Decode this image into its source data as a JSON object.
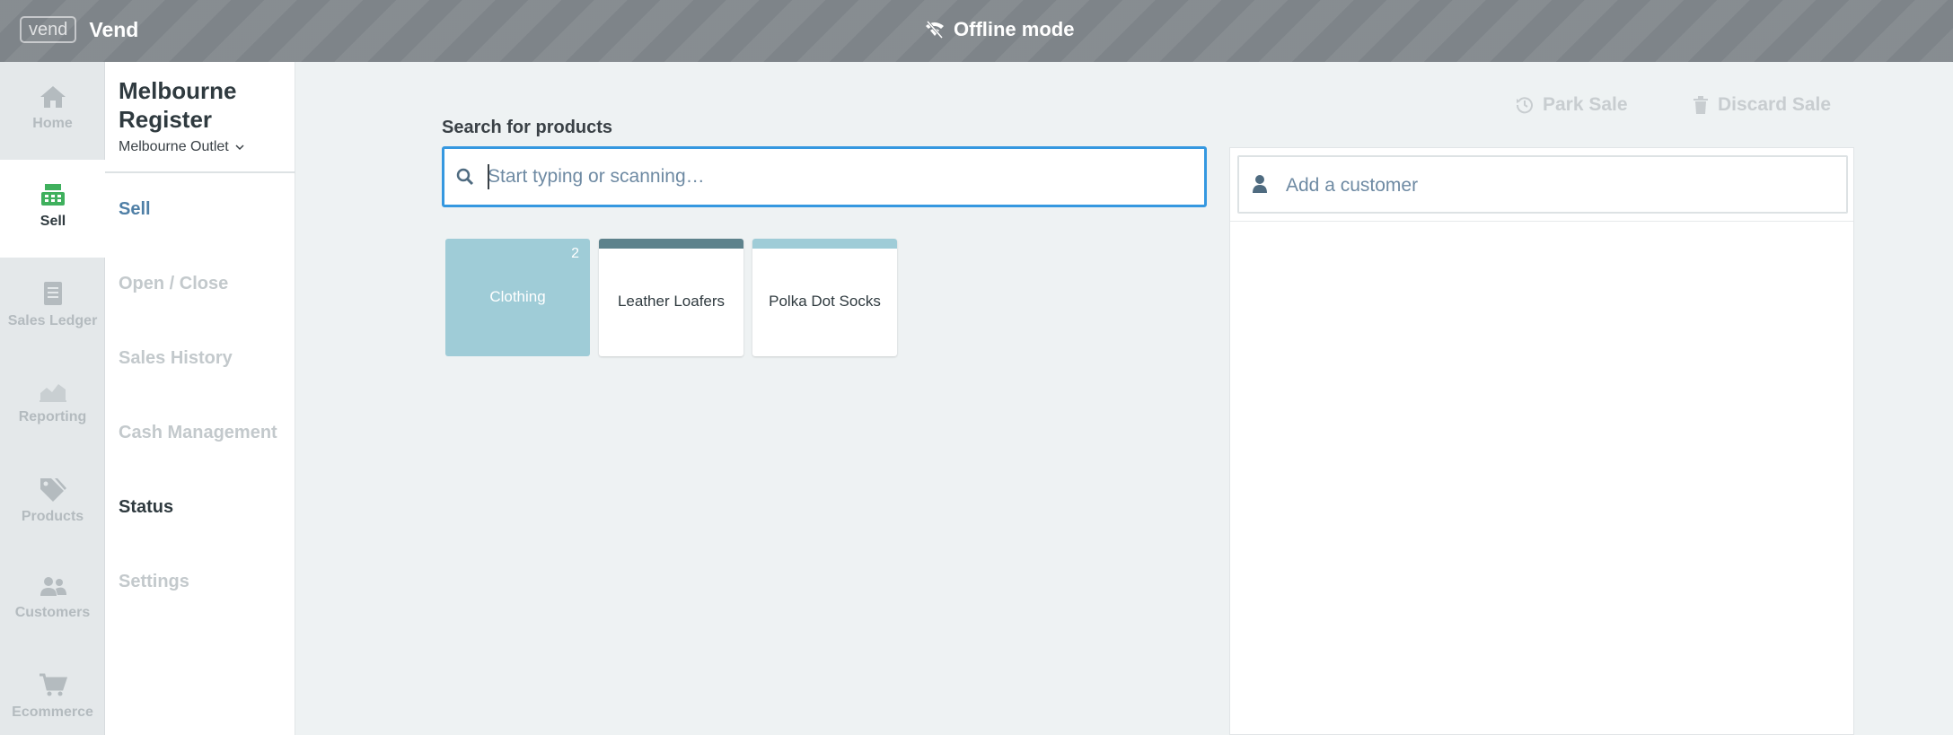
{
  "topbar": {
    "logo_text": "vend",
    "app_name": "Vend",
    "offline_label": "Offline mode"
  },
  "rail": {
    "items": [
      {
        "label": "Home",
        "icon": "home-icon"
      },
      {
        "label": "Sell",
        "icon": "register-icon",
        "active": true
      },
      {
        "label": "Sales Ledger",
        "icon": "ledger-icon"
      },
      {
        "label": "Reporting",
        "icon": "chart-icon"
      },
      {
        "label": "Products",
        "icon": "tags-icon"
      },
      {
        "label": "Customers",
        "icon": "users-icon"
      },
      {
        "label": "Ecommerce",
        "icon": "cart-icon"
      }
    ]
  },
  "subnav": {
    "register_title": "Melbourne Register",
    "outlet": "Melbourne Outlet",
    "items": [
      {
        "label": "Sell",
        "active": true
      },
      {
        "label": "Open / Close"
      },
      {
        "label": "Sales History"
      },
      {
        "label": "Cash Management"
      },
      {
        "label": "Status"
      },
      {
        "label": "Settings"
      }
    ]
  },
  "main": {
    "search_label": "Search for products",
    "search_placeholder": "Start typing or scanning…",
    "search_value": "",
    "park_sale": "Park Sale",
    "discard_sale": "Discard Sale",
    "tiles": [
      {
        "type": "folder",
        "name": "Clothing",
        "count": "2",
        "color": "#9fccd7"
      },
      {
        "type": "product",
        "name": "Leather Loafers",
        "bar_color": "#5d828c"
      },
      {
        "type": "product",
        "name": "Polka Dot Socks",
        "bar_color": "#9fccd7"
      }
    ],
    "customer_placeholder": "Add a customer"
  },
  "colors": {
    "accent": "#3598e0",
    "active_nav": "#4f7fa6",
    "sell_icon": "#3fb05d"
  }
}
